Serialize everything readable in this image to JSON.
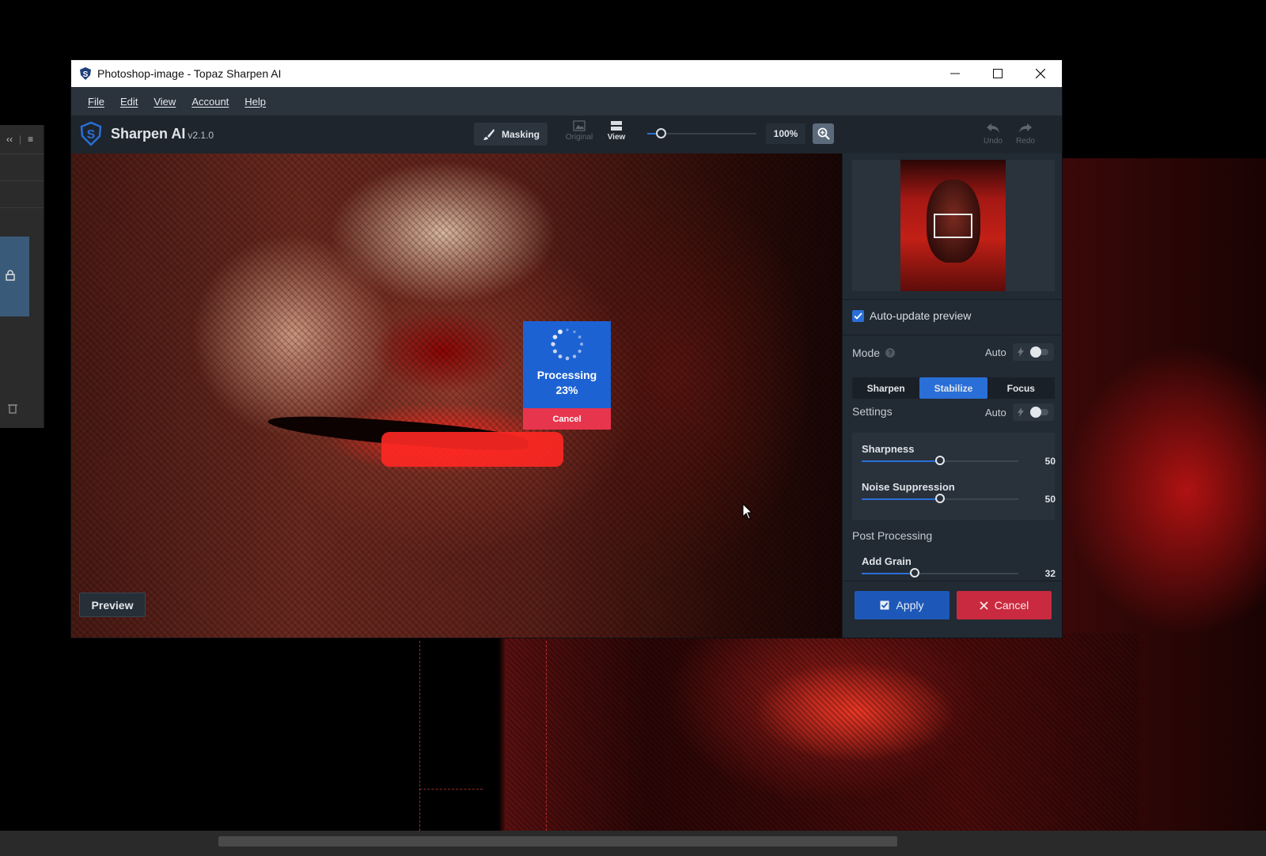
{
  "window": {
    "title": "Photoshop-image - Topaz Sharpen AI"
  },
  "menu": [
    "File",
    "Edit",
    "View",
    "Account",
    "Help"
  ],
  "brand": {
    "name": "Sharpen AI",
    "version": "v2.1.0"
  },
  "toolbar": {
    "masking_label": "Masking",
    "original_label": "Original",
    "view_label": "View",
    "zoom_value": "100%",
    "zoom_slider_fraction": 0.12,
    "undo_label": "Undo",
    "redo_label": "Redo"
  },
  "processing": {
    "label": "Processing",
    "percent": "23%",
    "cancel_label": "Cancel"
  },
  "preview_label": "Preview",
  "panel": {
    "auto_update_label": "Auto-update preview",
    "auto_update_checked": true,
    "mode_label": "Mode",
    "auto_label": "Auto",
    "modes": [
      "Sharpen",
      "Stabilize",
      "Focus"
    ],
    "active_mode": "Stabilize",
    "settings_label": "Settings",
    "sliders": [
      {
        "label": "Sharpness",
        "value": 50,
        "fraction": 0.5
      },
      {
        "label": "Noise Suppression",
        "value": 50,
        "fraction": 0.5
      }
    ],
    "post_processing_label": "Post Processing",
    "grain": {
      "label": "Add Grain",
      "value": 32,
      "fraction": 0.34
    },
    "apply_label": "Apply",
    "cancel_label": "Cancel"
  },
  "colors": {
    "accent": "#2a6fd8",
    "cancel": "#c92a3f",
    "processing": "#1d62d3"
  }
}
